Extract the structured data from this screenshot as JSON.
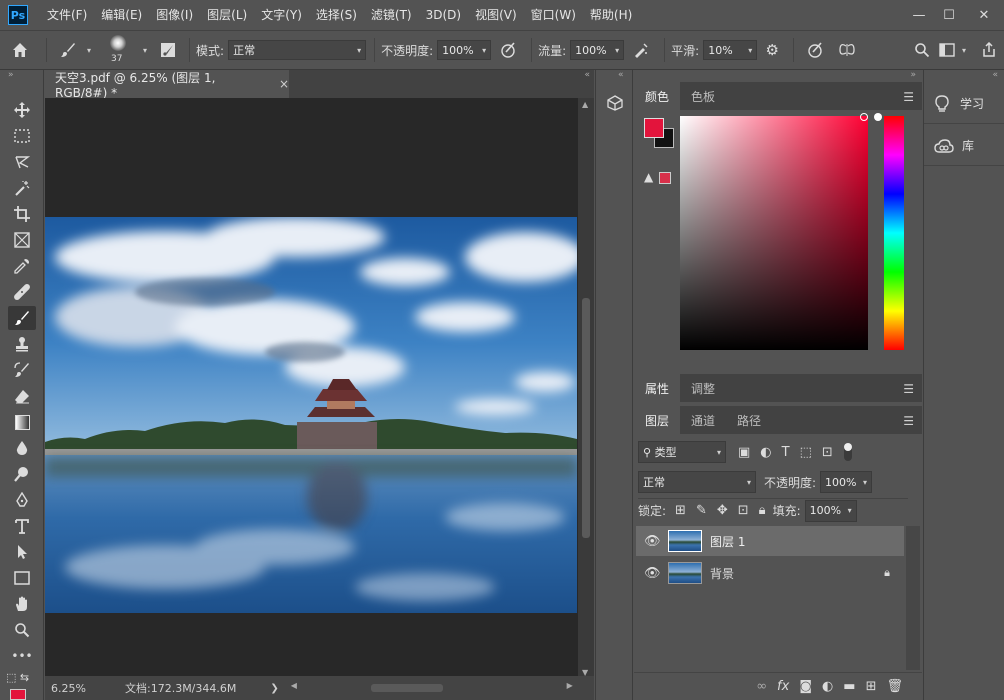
{
  "app": {
    "logo": "Ps"
  },
  "menu": [
    "文件(F)",
    "编辑(E)",
    "图像(I)",
    "图层(L)",
    "文字(Y)",
    "选择(S)",
    "滤镜(T)",
    "3D(D)",
    "视图(V)",
    "窗口(W)",
    "帮助(H)"
  ],
  "window_controls": {
    "minimize": "—",
    "maximize": "☐",
    "close": "✕"
  },
  "options": {
    "brush_size": "37",
    "mode_label": "模式:",
    "mode_value": "正常",
    "opacity_label": "不透明度:",
    "opacity_value": "100%",
    "flow_label": "流量:",
    "flow_value": "100%",
    "smoothing_label": "平滑:",
    "smoothing_value": "10%"
  },
  "document": {
    "tab_title": "天空3.pdf @ 6.25% (图层 1, RGB/8#) *",
    "tab_close": "×",
    "zoom": "6.25%",
    "doc_info": "文档:172.3M/344.6M",
    "status_arrow": "❯"
  },
  "color_panel": {
    "tabs": [
      "颜色",
      "色板"
    ],
    "foreground": "#e3143c",
    "background": "#111111",
    "hue": "#ff0033"
  },
  "props_panel": {
    "tabs": [
      "属性",
      "调整"
    ]
  },
  "layers_panel": {
    "tabs": [
      "图层",
      "通道",
      "路径"
    ],
    "filter_value": "类型",
    "blend_mode": "正常",
    "opacity_label": "不透明度:",
    "opacity_value": "100%",
    "lock_label": "锁定:",
    "fill_label": "填充:",
    "fill_value": "100%",
    "layers": [
      {
        "name": "图层 1",
        "selected": true,
        "locked": false
      },
      {
        "name": "背景",
        "selected": false,
        "locked": true
      }
    ]
  },
  "side": {
    "learn": "学习",
    "library": "库"
  },
  "icons": [
    "photoshop-logo",
    "home-icon",
    "brush-icon",
    "brush-settings-icon",
    "pressure-opacity-icon",
    "airbrush-icon",
    "gear-icon",
    "pressure-size-icon",
    "symmetry-icon",
    "search-icon",
    "workspace-icon",
    "share-icon",
    "move-icon",
    "marquee-icon",
    "lasso-icon",
    "magic-wand-icon",
    "crop-icon",
    "frame-icon",
    "eyedropper-icon",
    "healing-icon",
    "brush-tool-icon",
    "stamp-icon",
    "history-brush-icon",
    "eraser-icon",
    "gradient-icon",
    "blur-icon",
    "dodge-icon",
    "pen-icon",
    "type-icon",
    "path-select-icon",
    "rectangle-icon",
    "hand-icon",
    "zoom-icon",
    "more-icon",
    "swap-colors-icon",
    "3d-icon",
    "bulb-icon",
    "cloud-icon",
    "eye-icon",
    "lock-icon",
    "link-icon",
    "fx-icon",
    "mask-icon",
    "adjustment-icon",
    "folder-icon",
    "new-layer-icon",
    "trash-icon",
    "warning-icon"
  ]
}
